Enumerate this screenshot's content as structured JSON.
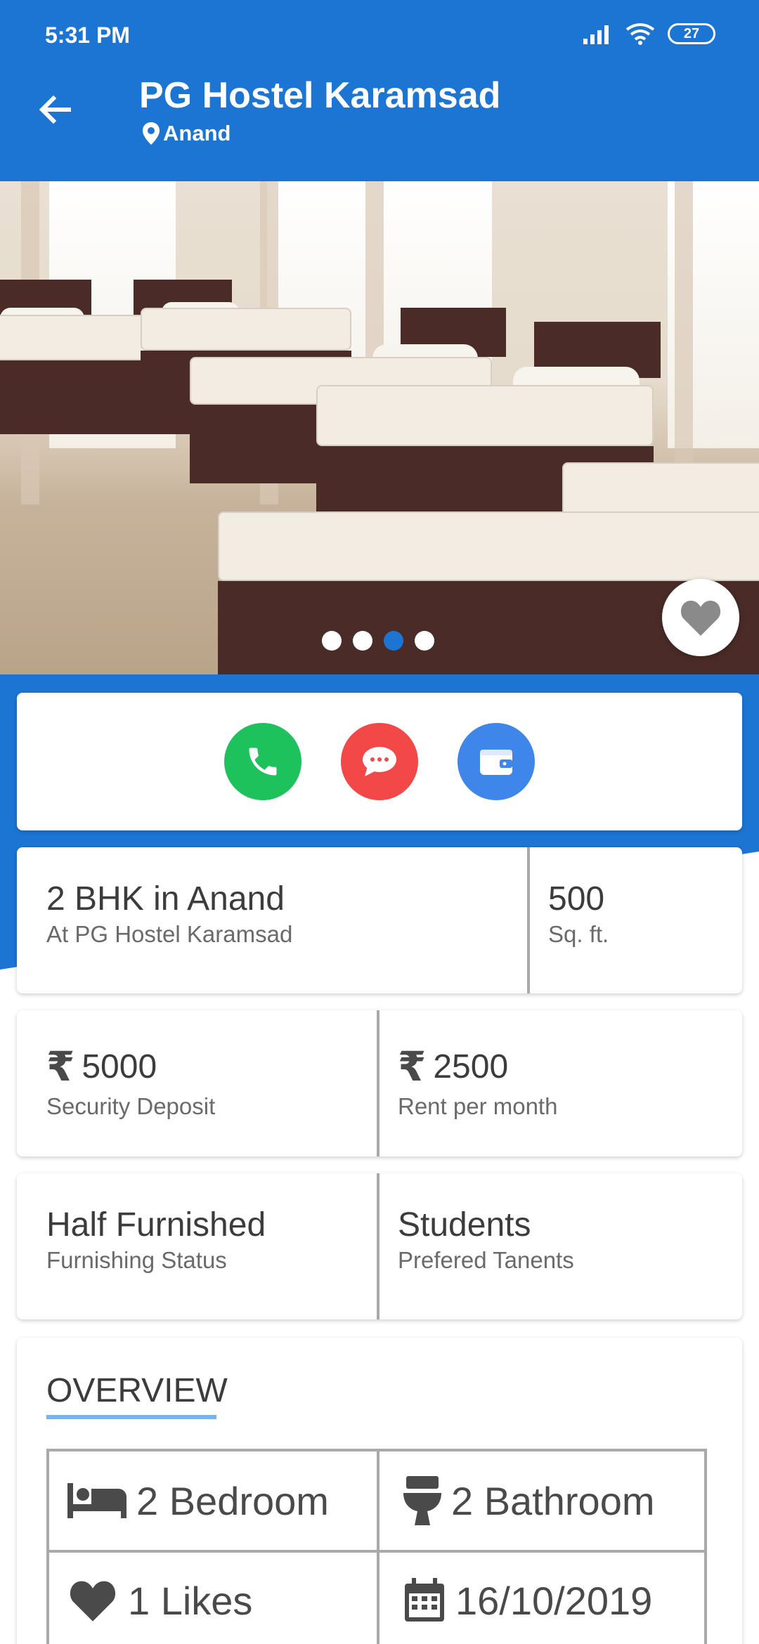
{
  "status_bar": {
    "time": "5:31 PM",
    "battery": "27"
  },
  "header": {
    "title": "PG Hostel Karamsad",
    "location": "Anand"
  },
  "gallery": {
    "image_count": 4,
    "active_index": 2
  },
  "summary": {
    "title": "2 BHK in Anand",
    "subtitle": "At PG Hostel Karamsad",
    "area_value": "500",
    "area_unit": "Sq. ft."
  },
  "pricing": {
    "currency_symbol": "₹",
    "deposit_value": "5000",
    "deposit_label": "Security Deposit",
    "rent_value": "2500",
    "rent_label": "Rent per month"
  },
  "details": {
    "furnishing_value": "Half Furnished",
    "furnishing_label": "Furnishing Status",
    "tenant_value": "Students",
    "tenant_label": "Prefered Tanents"
  },
  "overview": {
    "title": "OVERVIEW",
    "bedrooms": "2 Bedroom",
    "bathrooms": "2 Bathroom",
    "likes": "1 Likes",
    "date": "16/10/2019"
  },
  "colors": {
    "primary": "#1c75d3",
    "call": "#1ec25c",
    "message": "#f24848",
    "wallet": "#3f86ea",
    "accent_underline": "#74b5f0"
  },
  "icons": [
    "back-arrow-icon",
    "location-pin-icon",
    "signal-icon",
    "wifi-icon",
    "battery-icon",
    "heart-icon",
    "phone-icon",
    "chat-icon",
    "wallet-icon",
    "bed-icon",
    "toilet-icon",
    "calendar-icon"
  ]
}
